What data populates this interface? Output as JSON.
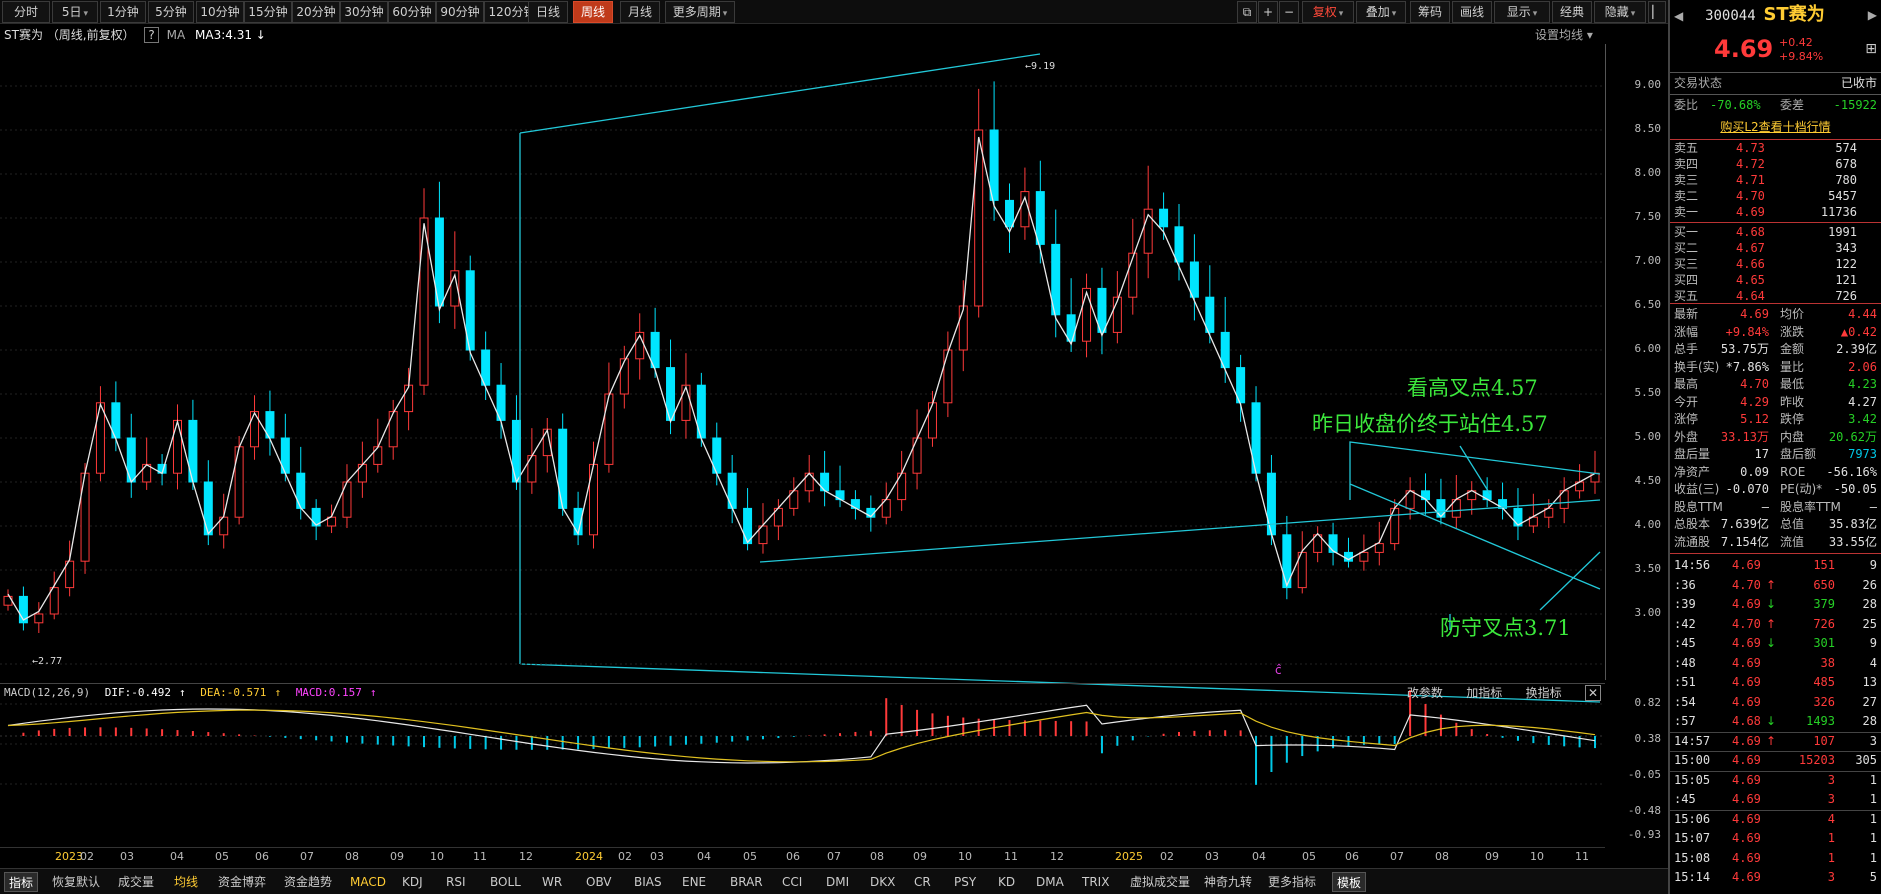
{
  "toolbar": {
    "periods": [
      "分时",
      "5日",
      "1分钟",
      "5分钟",
      "10分钟",
      "15分钟",
      "20分钟",
      "30分钟",
      "60分钟",
      "90分钟",
      "120分钟",
      "日线",
      "周线",
      "月线",
      "更多周期"
    ],
    "active_period": "周线",
    "right_buttons": [
      "复权",
      "叠加",
      "筹码",
      "画线",
      "显示",
      "经典",
      "隐藏"
    ]
  },
  "chart": {
    "title": "ST赛为 （周线,前复权）",
    "help": "?",
    "ma_label": "MA",
    "ma3": "MA3:4.31",
    "ma_settings": "设置均线",
    "y_labels": [
      "9.00",
      "8.50",
      "8.00",
      "7.50",
      "7.00",
      "6.50",
      "6.00",
      "5.50",
      "5.00",
      "4.50",
      "4.00",
      "3.50",
      "3.00"
    ],
    "high_marker": "9.19",
    "low_marker": "2.77",
    "annotations": {
      "cross_high": "看高叉点4.57",
      "close_above": "昨日收盘价终于站住4.57",
      "cross_defend": "防守叉点3.71"
    },
    "event_marker": "ĉ"
  },
  "macd": {
    "name": "MACD(12,26,9)",
    "dif": "DIF:-0.492",
    "dea": "DEA:-0.571",
    "macd": "MACD:0.157",
    "tools": [
      "改参数",
      "加指标",
      "换指标"
    ],
    "y_labels": [
      "0.82",
      "0.38",
      "-0.05",
      "-0.48",
      "-0.93"
    ]
  },
  "x_labels": [
    "2023",
    "02",
    "03",
    "04",
    "05",
    "06",
    "07",
    "08",
    "09",
    "10",
    "11",
    "12",
    "2024",
    "02",
    "03",
    "04",
    "05",
    "06",
    "07",
    "08",
    "09",
    "10",
    "11",
    "12",
    "2025",
    "02",
    "03",
    "04",
    "05",
    "06",
    "07",
    "08",
    "09",
    "10",
    "11"
  ],
  "bottom_tabs": [
    "指标",
    "恢复默认",
    "成交量",
    "均线",
    "资金博弈",
    "资金趋势",
    "MACD",
    "KDJ",
    "RSI",
    "BOLL",
    "WR",
    "OBV",
    "BIAS",
    "ENE",
    "BRAR",
    "CCI",
    "DMI",
    "DKX",
    "CR",
    "PSY",
    "KD",
    "DMA",
    "TRIX",
    "虚拟成交量",
    "神奇九转",
    "更多指标",
    "模板"
  ],
  "panel": {
    "code": "300044",
    "name": "ST赛为",
    "price": "4.69",
    "change": "+0.42",
    "change_pct": "+9.84%",
    "status_label": "交易状态",
    "status_value": "已收市",
    "webi_label": "委比",
    "webi_value": "-70.68%",
    "weicha_label": "委差",
    "weicha_value": "-15922",
    "l2_link": "购买L2查看十档行情",
    "asks": [
      {
        "label": "卖五",
        "price": "4.73",
        "vol": "574"
      },
      {
        "label": "卖四",
        "price": "4.72",
        "vol": "678"
      },
      {
        "label": "卖三",
        "price": "4.71",
        "vol": "780"
      },
      {
        "label": "卖二",
        "price": "4.70",
        "vol": "5457"
      },
      {
        "label": "卖一",
        "price": "4.69",
        "vol": "11736"
      }
    ],
    "bids": [
      {
        "label": "买一",
        "price": "4.68",
        "vol": "1991"
      },
      {
        "label": "买二",
        "price": "4.67",
        "vol": "343"
      },
      {
        "label": "买三",
        "price": "4.66",
        "vol": "122"
      },
      {
        "label": "买四",
        "price": "4.65",
        "vol": "121"
      },
      {
        "label": "买五",
        "price": "4.64",
        "vol": "726"
      }
    ],
    "stats": [
      [
        "最新",
        "4.69",
        "均价",
        "4.44"
      ],
      [
        "涨幅",
        "+9.84%",
        "涨跌",
        "▲0.42"
      ],
      [
        "总手",
        "53.75万",
        "金额",
        "2.39亿"
      ],
      [
        "换手(实)",
        "*7.86%",
        "量比",
        "2.06"
      ],
      [
        "最高",
        "4.70",
        "最低",
        "4.23"
      ],
      [
        "今开",
        "4.29",
        "昨收",
        "4.27"
      ],
      [
        "涨停",
        "5.12",
        "跌停",
        "3.42"
      ],
      [
        "外盘",
        "33.13万",
        "内盘",
        "20.62万"
      ],
      [
        "盘后量",
        "17",
        "盘后额",
        "7973"
      ],
      [
        "净资产",
        "0.09",
        "ROE",
        "-56.16%"
      ],
      [
        "收益(三)",
        "-0.070",
        "PE(动)*",
        "-50.05"
      ],
      [
        "股息TTM",
        "—",
        "股息率TTM",
        "—"
      ],
      [
        "总股本",
        "7.639亿",
        "总值",
        "35.83亿"
      ],
      [
        "流通股",
        "7.154亿",
        "流值",
        "33.55亿"
      ]
    ],
    "ticks": [
      [
        "14:56",
        "4.69",
        "151",
        "9",
        ""
      ],
      [
        ":36",
        "4.70",
        "650",
        "26",
        "up"
      ],
      [
        ":39",
        "4.69",
        "379",
        "28",
        "down"
      ],
      [
        ":42",
        "4.70",
        "726",
        "25",
        "up"
      ],
      [
        ":45",
        "4.69",
        "301",
        "9",
        "down"
      ],
      [
        ":48",
        "4.69",
        "38",
        "4",
        ""
      ],
      [
        ":51",
        "4.69",
        "485",
        "13",
        ""
      ],
      [
        ":54",
        "4.69",
        "326",
        "27",
        ""
      ],
      [
        ":57",
        "4.68",
        "1493",
        "28",
        "down"
      ],
      [
        "14:57",
        "4.69",
        "107",
        "3",
        "up"
      ],
      [
        "15:00",
        "4.69",
        "15203",
        "305",
        ""
      ],
      [
        "15:05",
        "4.69",
        "3",
        "1",
        ""
      ],
      [
        ":45",
        "4.69",
        "3",
        "1",
        ""
      ],
      [
        "15:06",
        "4.69",
        "4",
        "1",
        ""
      ],
      [
        "15:07",
        "4.69",
        "1",
        "1",
        ""
      ],
      [
        "15:08",
        "4.69",
        "1",
        "1",
        ""
      ],
      [
        "15:14",
        "4.69",
        "3",
        "5",
        ""
      ]
    ]
  }
}
